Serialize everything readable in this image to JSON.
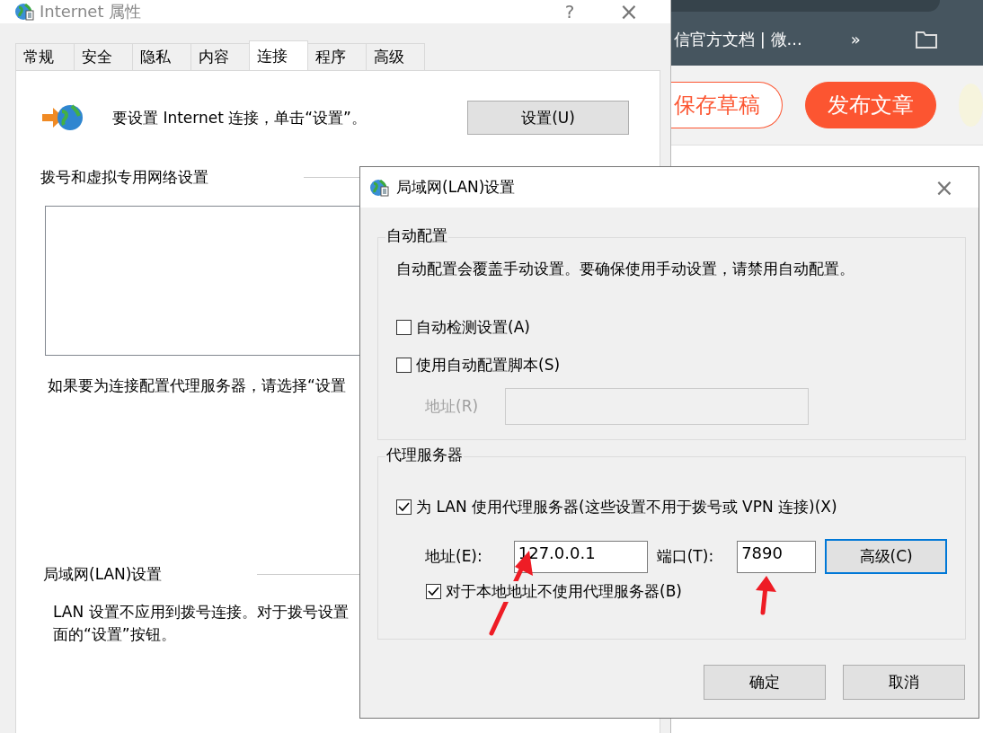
{
  "browser": {
    "bookmark": "信官方文档 | 微...",
    "overflow": "»",
    "buttons": [
      {
        "label": "保存草稿",
        "kind": "outline"
      },
      {
        "label": "发布文章",
        "kind": "filled"
      }
    ]
  },
  "properties_window": {
    "title": "Internet 属性",
    "help": "?",
    "close": "×",
    "tabs": [
      {
        "label": "常规",
        "selected": false
      },
      {
        "label": "安全",
        "selected": false
      },
      {
        "label": "隐私",
        "selected": false
      },
      {
        "label": "内容",
        "selected": false
      },
      {
        "label": "连接",
        "selected": true
      },
      {
        "label": "程序",
        "selected": false
      },
      {
        "label": "高级",
        "selected": false
      }
    ],
    "setup_text": "要设置 Internet 连接，单击“设置”。",
    "setup_button": "设置(U)",
    "dialup_heading": "拨号和虚拟专用网络设置",
    "proxy_hint": "如果要为连接配置代理服务器，请选择“设置",
    "lan_heading": "局域网(LAN)设置",
    "lan_note_lines": [
      "LAN 设置不应用到拨号连接。对于拨号设置",
      "面的“设置”按钮。"
    ]
  },
  "lan_dialog": {
    "title": "局域网(LAN)设置",
    "close": "×",
    "auto_group": {
      "title": "自动配置",
      "description": "自动配置会覆盖手动设置。要确保使用手动设置，请禁用自动配置。",
      "options": [
        {
          "label": "自动检测设置(A)",
          "checked": false
        },
        {
          "label": "使用自动配置脚本(S)",
          "checked": false
        }
      ],
      "address": {
        "label": "地址(R)",
        "disabled": true
      }
    },
    "proxy_group": {
      "title": "代理服务器",
      "use_proxy": {
        "label": "为 LAN 使用代理服务器(这些设置不用于拨号或 VPN 连接)(X)",
        "checked": true
      },
      "address": {
        "label": "地址(E):",
        "value": "127.0.0.1"
      },
      "port": {
        "label": "端口(T):",
        "value": "7890"
      },
      "advanced_button": "高级(C)",
      "bypass_local": {
        "label": "对于本地地址不使用代理服务器(B)",
        "checked": true
      }
    },
    "buttons": [
      "确定",
      "取消"
    ]
  }
}
